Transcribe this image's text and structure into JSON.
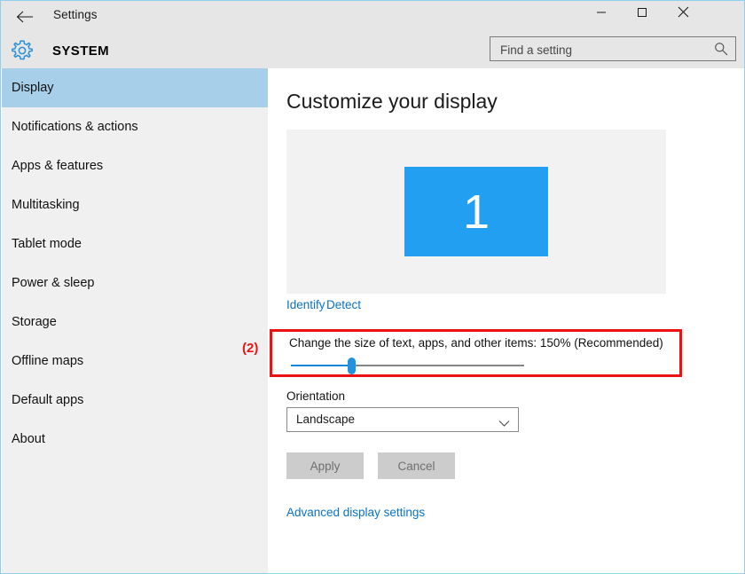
{
  "window": {
    "app_title": "Settings",
    "section_title": "SYSTEM",
    "back_icon": "back-arrow-icon",
    "gear_icon": "gear-icon",
    "controls": {
      "minimize": "minimize-icon",
      "maximize": "maximize-icon",
      "close": "close-icon"
    }
  },
  "search": {
    "placeholder": "Find a setting",
    "value": "",
    "icon": "search-icon"
  },
  "sidebar": {
    "items": [
      {
        "label": "Display",
        "selected": true
      },
      {
        "label": "Notifications & actions",
        "selected": false
      },
      {
        "label": "Apps & features",
        "selected": false
      },
      {
        "label": "Multitasking",
        "selected": false
      },
      {
        "label": "Tablet mode",
        "selected": false
      },
      {
        "label": "Power & sleep",
        "selected": false
      },
      {
        "label": "Storage",
        "selected": false
      },
      {
        "label": "Offline maps",
        "selected": false
      },
      {
        "label": "Default apps",
        "selected": false
      },
      {
        "label": "About",
        "selected": false
      }
    ]
  },
  "main": {
    "page_title": "Customize your display",
    "display_preview": {
      "monitor_number": "1"
    },
    "links": {
      "identify": "Identify",
      "detect": "Detect"
    },
    "scale": {
      "label": "Change the size of text, apps, and other items: 150% (Recommended)",
      "value_percent": "150%",
      "recommended_suffix": "(Recommended)",
      "slider_position_percent": 25
    },
    "orientation": {
      "label": "Orientation",
      "selected": "Landscape",
      "chevron_icon": "chevron-down-icon"
    },
    "buttons": {
      "apply": "Apply",
      "cancel": "Cancel"
    },
    "advanced_link": "Advanced display settings"
  },
  "annotations": [
    {
      "label": "(2)",
      "target": "scale-section"
    }
  ],
  "colors": {
    "accent_blue": "#229ff0",
    "link_blue": "#0c72c4",
    "selection_blue": "#a7cfe9",
    "annotation_red": "#ee1111",
    "titlebar_gray": "#e6e6e6",
    "sidebar_gray": "#f0f0f0",
    "preview_gray": "#f2f2f2",
    "button_gray": "#cccccc"
  }
}
